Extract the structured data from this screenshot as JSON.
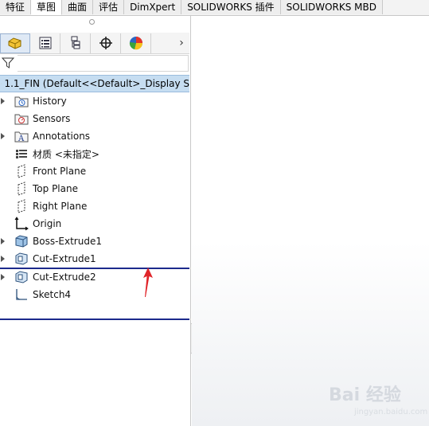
{
  "command_tabs": [
    "特征",
    "草图",
    "曲面",
    "评估",
    "DimXpert",
    "SOLIDWORKS 插件",
    "SOLIDWORKS MBD"
  ],
  "active_tab_index": 1,
  "manager_icons": [
    "part-icon",
    "property-manager-icon",
    "config-manager-icon",
    "dimxpert-icon",
    "display-manager-icon"
  ],
  "root": {
    "label": "1.1_FIN  (Default<<Default>_Display S"
  },
  "tree": [
    {
      "label": "History",
      "icon": "history-folder-icon",
      "expandable": true
    },
    {
      "label": "Sensors",
      "icon": "sensors-icon",
      "expandable": false
    },
    {
      "label": "Annotations",
      "icon": "annotations-icon",
      "expandable": true
    },
    {
      "label": "材质 <未指定>",
      "icon": "material-icon",
      "expandable": false
    },
    {
      "label": "Front Plane",
      "icon": "plane-icon",
      "expandable": false
    },
    {
      "label": "Top Plane",
      "icon": "plane-icon",
      "expandable": false
    },
    {
      "label": "Right Plane",
      "icon": "plane-icon",
      "expandable": false
    },
    {
      "label": "Origin",
      "icon": "origin-icon",
      "expandable": false
    },
    {
      "label": "Boss-Extrude1",
      "icon": "boss-extrude-icon",
      "expandable": true
    },
    {
      "label": "Cut-Extrude1",
      "icon": "cut-extrude-icon",
      "expandable": true
    },
    {
      "label": "Cut-Extrude2",
      "icon": "cut-extrude-icon",
      "expandable": true
    },
    {
      "label": "Sketch4",
      "icon": "sketch-icon",
      "expandable": false
    }
  ],
  "watermark": {
    "text": "Bai 经验",
    "sub": "jingyan.baidu.com"
  },
  "colors": {
    "selection": "#c6ddf1",
    "rollback_bar": "#1c2a8c",
    "annotation_arrow": "#e0252a"
  }
}
